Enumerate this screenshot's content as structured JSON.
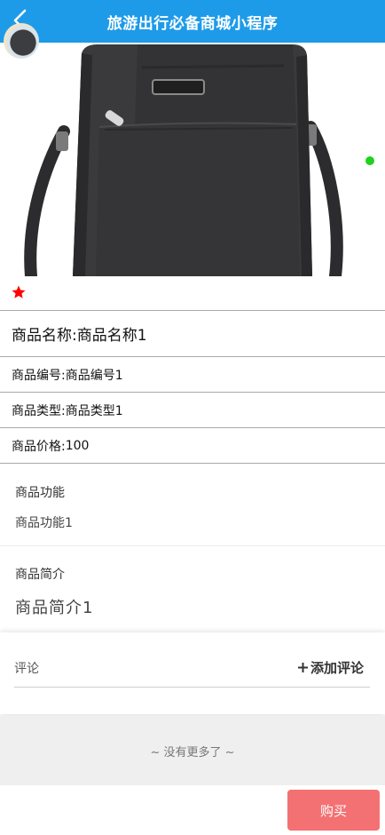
{
  "header": {
    "title": "旅游出行必备商城小程序"
  },
  "product": {
    "name_label": "商品名称:",
    "name_value": "商品名称1",
    "code_label": "商品编号:",
    "code_value": "商品编号1",
    "type_label": "商品类型:",
    "type_value": "商品类型1",
    "price_label": "商品价格:",
    "price_value": "100"
  },
  "function_section": {
    "title": "商品功能",
    "body": "商品功能1"
  },
  "intro_section": {
    "title": "商品简介",
    "body": "商品简介1"
  },
  "comments": {
    "label": "评论",
    "add_label": "添加评论"
  },
  "footer": {
    "no_more": "~ 没有更多了 ~",
    "buy_label": "购买"
  },
  "colors": {
    "header": "#1e9be8",
    "buy": "#f37173",
    "favorite": "#ff0000",
    "indicator": "#1ed21e"
  }
}
